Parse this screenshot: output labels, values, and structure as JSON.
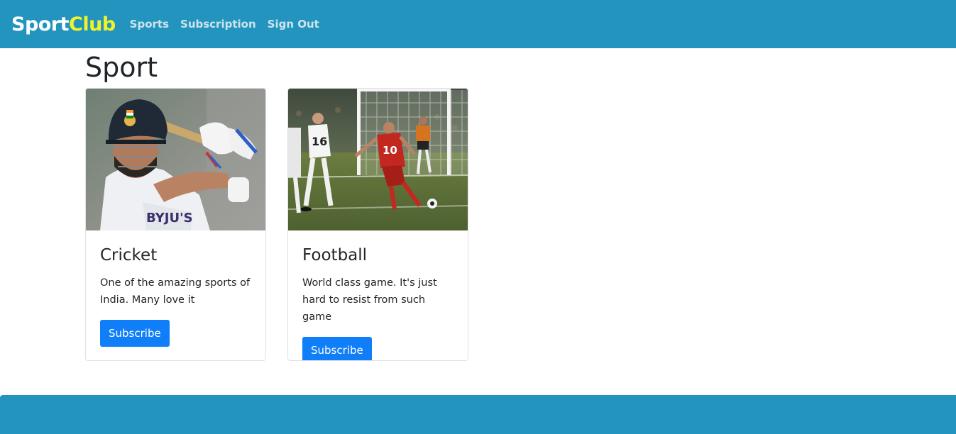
{
  "navbar": {
    "brand_part1": "Sport",
    "brand_part2": "Club",
    "links": [
      "Sports",
      "Subscription",
      "Sign Out"
    ]
  },
  "main": {
    "title": "Sport",
    "cards": [
      {
        "title": "Cricket",
        "text": "One of the amazing sports of India. Many love it",
        "button": "Subscribe",
        "image": "cricket-player-photo"
      },
      {
        "title": "Football",
        "text": "World class game. It's just hard to resist from such game",
        "button": "Subscribe",
        "image": "football-match-photo"
      }
    ]
  },
  "colors": {
    "navbar_bg": "#2394be",
    "brand_accent": "#f2f22a",
    "button_bg": "#0f7ef8"
  }
}
